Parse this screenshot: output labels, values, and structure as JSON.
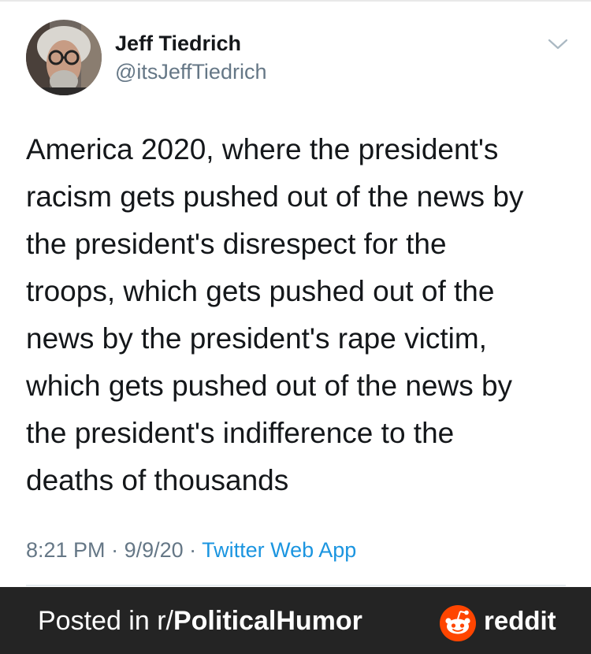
{
  "tweet": {
    "author_name": "Jeff Tiedrich",
    "author_handle": "@itsJeffTiedrich",
    "text_lines": [
      "America 2020, where the president's",
      "racism gets pushed out of the news by",
      "the president's disrespect for the",
      "troops, which gets pushed out of the",
      "news by the president's rape victim,",
      "which gets pushed out of the news by",
      "the president's indifference to the",
      "deaths of thousands"
    ],
    "time": "8:21 PM",
    "separator": " · ",
    "date": "9/9/20",
    "source": "Twitter Web App"
  },
  "footer": {
    "posted_prefix": "Posted in r/",
    "subreddit": "PoliticalHumor",
    "brand": "reddit"
  },
  "colors": {
    "text": "#14171a",
    "secondary": "#657786",
    "link": "#1b95e0",
    "footer_bg": "#242424",
    "reddit_orange": "#ff4500"
  },
  "icons": {
    "avatar": "profile-photo",
    "menu": "chevron-down-icon",
    "brand": "reddit-snoo-icon"
  }
}
